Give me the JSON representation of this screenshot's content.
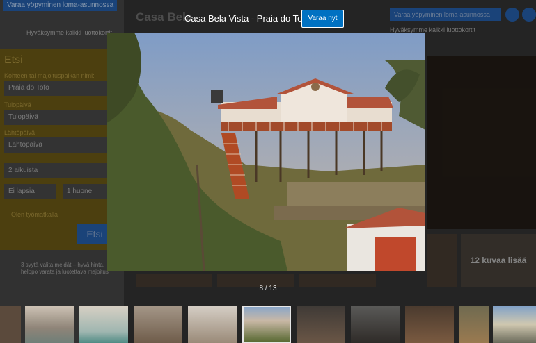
{
  "background": {
    "top_book_button": "Varaa yöpyminen loma-asunnossa",
    "guarantee": "Hyväksymme kaikki luottokortit",
    "search": {
      "title": "Etsi",
      "destination_label": "Kohteen tai majoituspaikan nimi:",
      "destination_value": "Praia do Tofo",
      "checkin_label": "Tulopäivä",
      "checkin_value": "Tulopäivä",
      "checkout_label": "Lähtöpäivä",
      "checkout_value": "Lähtöpäivä",
      "guests_value": "2 aikuista",
      "children_value": "Ei lapsia",
      "rooms_value": "1 huone",
      "work_trip_label": "Olen työmatkalla",
      "button": "Etsi"
    },
    "promise": "3 syytä valita meidät – hyvä hinta, helppo varata ja luotettava majoitus",
    "property_title": "Casa Bela",
    "right_book_button": "Varaa yöpyminen loma-asunnossa",
    "right_guarantee": "Hyväksymme kaikki luottokortit",
    "more_photos": "12 kuvaa lisää"
  },
  "lightbox": {
    "title": "Casa Bela Vista - Praia do Tofo",
    "book_button": "Varaa nyt",
    "counter": "8 / 13",
    "active_index": 5
  },
  "thumbnails": [
    {
      "name": "room-thumbnail-1"
    },
    {
      "name": "room-thumbnail-2"
    },
    {
      "name": "room-thumbnail-3"
    },
    {
      "name": "room-thumbnail-4"
    },
    {
      "name": "room-thumbnail-5"
    },
    {
      "name": "house-thumbnail"
    },
    {
      "name": "interior-thumbnail-1"
    },
    {
      "name": "interior-thumbnail-2"
    },
    {
      "name": "interior-thumbnail-3"
    },
    {
      "name": "deck-thumbnail"
    },
    {
      "name": "outdoor-thumbnail"
    },
    {
      "name": "beach-thumbnail"
    }
  ],
  "colors": {
    "accent": "#0071c2"
  }
}
